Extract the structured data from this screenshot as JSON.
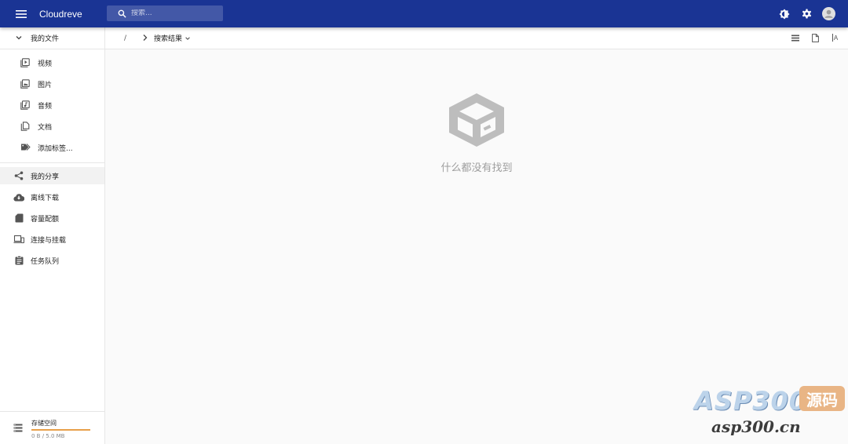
{
  "appbar": {
    "title": "Cloudreve",
    "search_placeholder": "搜索..."
  },
  "sidebar": {
    "my_files": "我的文件",
    "sub_items": [
      {
        "label": "视频",
        "icon": "video-file-icon"
      },
      {
        "label": "图片",
        "icon": "image-file-icon"
      },
      {
        "label": "音频",
        "icon": "audio-file-icon"
      },
      {
        "label": "文档",
        "icon": "document-icon"
      },
      {
        "label": "添加标签...",
        "icon": "tag-icon"
      }
    ],
    "items": [
      {
        "label": "我的分享",
        "icon": "share-icon"
      },
      {
        "label": "离线下载",
        "icon": "cloud-download-icon"
      },
      {
        "label": "容量配额",
        "icon": "sd-card-icon"
      },
      {
        "label": "连接与挂载",
        "icon": "devices-icon"
      },
      {
        "label": "任务队列",
        "icon": "clipboard-icon"
      }
    ],
    "storage": {
      "label": "存储空间",
      "capacity": "0 B / 5.0 MB",
      "used_fraction": 1.0
    }
  },
  "breadcrumb": {
    "root": "/",
    "current": "搜索结果"
  },
  "view": {
    "sort_label": "A"
  },
  "empty_state": {
    "message": "什么都没有找到"
  },
  "watermark": {
    "brand": "ASP300",
    "badge": "源码",
    "site": "asp300.cn"
  },
  "colors": {
    "primary": "#1a3494",
    "accent": "#e8a04a",
    "empty_icon": "#bdbdbd"
  }
}
